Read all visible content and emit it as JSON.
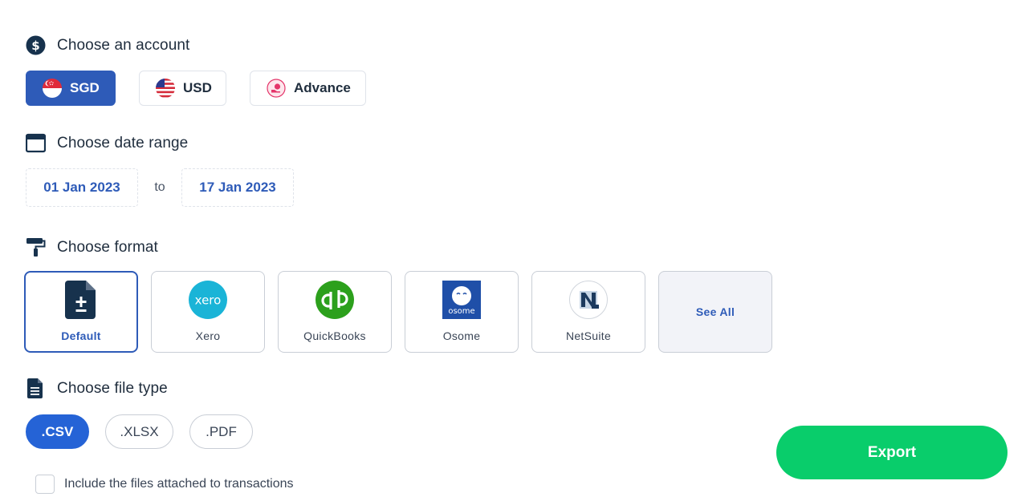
{
  "account": {
    "title": "Choose an account",
    "options": [
      {
        "label": "SGD",
        "selected": true
      },
      {
        "label": "USD",
        "selected": false
      },
      {
        "label": "Advance",
        "selected": false
      }
    ]
  },
  "date_range": {
    "title": "Choose date range",
    "from": "01 Jan 2023",
    "separator": "to",
    "to": "17 Jan 2023"
  },
  "format": {
    "title": "Choose format",
    "options": [
      {
        "label": "Default",
        "icon": "document-add-icon",
        "selected": true
      },
      {
        "label": "Xero",
        "icon": "xero-logo",
        "selected": false
      },
      {
        "label": "QuickBooks",
        "icon": "quickbooks-logo",
        "selected": false
      },
      {
        "label": "Osome",
        "icon": "osome-logo",
        "selected": false
      },
      {
        "label": "NetSuite",
        "icon": "netsuite-logo",
        "selected": false
      }
    ],
    "see_all": "See All",
    "xero_logo_text": "xero",
    "osome_logo_text": "osome"
  },
  "file_type": {
    "title": "Choose file type",
    "options": [
      {
        "label": ".CSV",
        "selected": true
      },
      {
        "label": ".XLSX",
        "selected": false
      },
      {
        "label": ".PDF",
        "selected": false
      }
    ]
  },
  "include_attachments": {
    "label": "Include the files attached to transactions",
    "checked": false
  },
  "export_label": "Export",
  "colors": {
    "primary": "#2e5bb8",
    "export": "#09cd6b",
    "xero": "#1ab4d7",
    "quickbooks": "#2ca01c",
    "osome": "#1f4fa8"
  }
}
